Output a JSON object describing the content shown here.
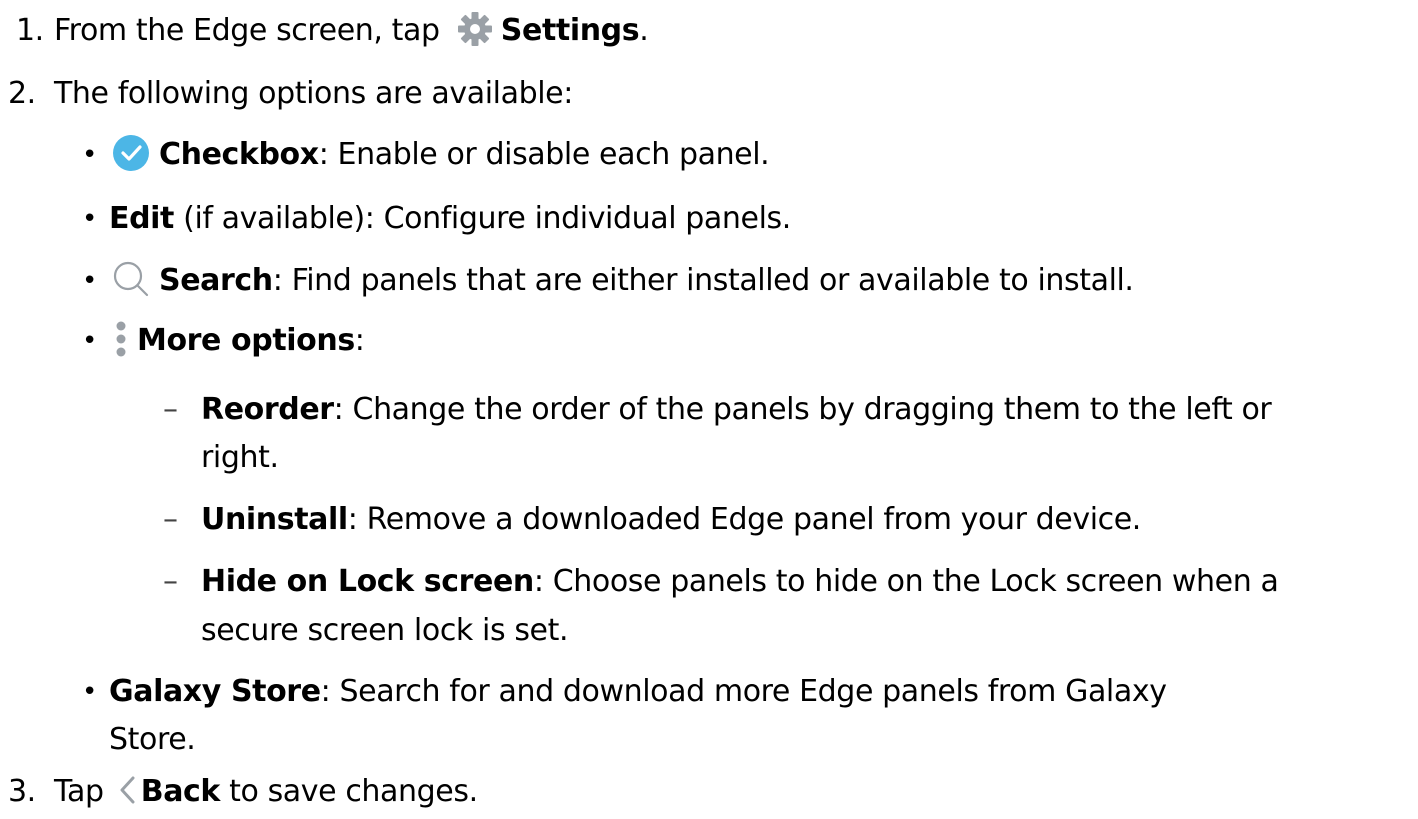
{
  "steps": [
    {
      "number": "1.",
      "text_before": "From the Edge screen, tap",
      "icon": "gear-icon",
      "bold": "Settings",
      "text_after": "."
    },
    {
      "number": "2.",
      "text": "The following options are available:"
    },
    {
      "number": "3.",
      "text_before": "Tap",
      "icon": "chevron-left-icon",
      "bold": "Back",
      "text_after": " to save changes."
    }
  ],
  "options": [
    {
      "bullet": "•",
      "icon": "checkbox-checked-icon",
      "bold": "Checkbox",
      "text": ": Enable or disable each panel."
    },
    {
      "bullet": "•",
      "bold": "Edit",
      "text": " (if available): Configure individual panels."
    },
    {
      "bullet": "•",
      "icon": "search-icon",
      "bold": "Search",
      "text": ": Find panels that are either installed or available to install."
    },
    {
      "bullet": "•",
      "icon": "more-options-icon",
      "bold": "More options",
      "text": ":"
    },
    {
      "bullet": "•",
      "bold": "Galaxy Store",
      "text": ": Search for and download more Edge panels from Galaxy",
      "continuation": "Store."
    }
  ],
  "more_options": [
    {
      "dash": "–",
      "bold": "Reorder",
      "text": ": Change the order of the panels by dragging them to the left or",
      "continuation": "right."
    },
    {
      "dash": "–",
      "bold": "Uninstall",
      "text": ": Remove a downloaded Edge panel from your device."
    },
    {
      "dash": "–",
      "bold": "Hide on Lock screen",
      "text": ": Choose panels to hide on the Lock screen when a",
      "continuation": "secure screen lock is set."
    }
  ],
  "colors": {
    "checkbox": "#4cb6e6",
    "gear": "#9aa0a6",
    "search": "#9aa0a6",
    "more": "#9aa0a6",
    "chevron": "#9aa0a6"
  }
}
